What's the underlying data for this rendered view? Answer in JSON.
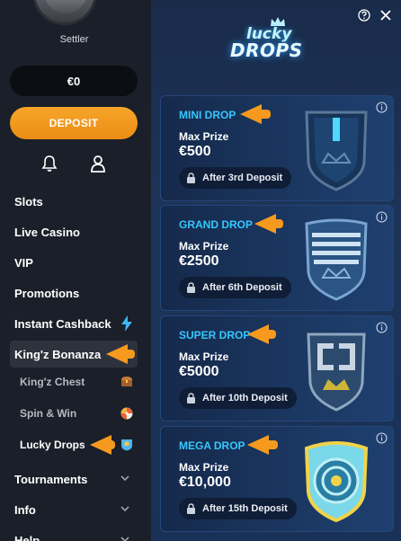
{
  "user": {
    "name": "Settler",
    "balance": "€0"
  },
  "sidebar": {
    "deposit_label": "DEPOSIT",
    "items": [
      {
        "label": "Slots"
      },
      {
        "label": "Live Casino"
      },
      {
        "label": "VIP"
      },
      {
        "label": "Promotions"
      },
      {
        "label": "Instant Cashback"
      },
      {
        "label": "King'z Bonanza"
      },
      {
        "label": "King'z Chest"
      },
      {
        "label": "Spin & Win"
      },
      {
        "label": "Lucky Drops"
      },
      {
        "label": "Tournaments"
      },
      {
        "label": "Info"
      },
      {
        "label": "Help"
      }
    ]
  },
  "logo": {
    "line1": "lucky",
    "line2": "DROPS"
  },
  "drops": [
    {
      "title": "MINI DROP",
      "subtitle": "Max Prize",
      "prize": "€500",
      "requirement": "After 3rd Deposit",
      "color": "#35c7ff"
    },
    {
      "title": "GRAND DROP",
      "subtitle": "Max Prize",
      "prize": "€2500",
      "requirement": "After 6th Deposit",
      "color": "#35c7ff"
    },
    {
      "title": "SUPER DROP",
      "subtitle": "Max Prize",
      "prize": "€5000",
      "requirement": "After 10th Deposit",
      "color": "#35c7ff"
    },
    {
      "title": "MEGA DROP",
      "subtitle": "Max Prize",
      "prize": "€10,000",
      "requirement": "After 15th Deposit",
      "color": "#35c7ff"
    }
  ],
  "colors": {
    "accent": "#f59a1f",
    "title_blue": "#35c7ff",
    "sidebar_bg": "#1a1f29",
    "main_bg": "#1c3458"
  }
}
